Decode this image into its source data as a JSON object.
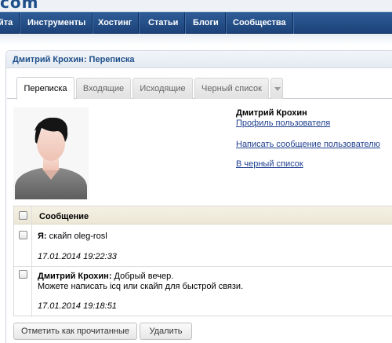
{
  "site": {
    "logo_fragment": "com"
  },
  "nav": {
    "items": [
      {
        "label": "йта"
      },
      {
        "label": "Инструменты"
      },
      {
        "label": "Хостинг"
      },
      {
        "label": "Статьи"
      },
      {
        "label": "Блоги"
      },
      {
        "label": "Сообщества"
      }
    ]
  },
  "panel": {
    "title": "Дмитрий Крохин: Переписка"
  },
  "tabs": [
    {
      "label": "Переписка",
      "active": true
    },
    {
      "label": "Входящие",
      "active": false
    },
    {
      "label": "Исходящие",
      "active": false
    },
    {
      "label": "Черный список",
      "active": false
    }
  ],
  "user": {
    "name": "Дмитрий Крохин",
    "links": {
      "profile": "Профиль пользователя",
      "write_message": "Написать сообщение пользователю",
      "blacklist": "В черный список"
    }
  },
  "messages": {
    "column_header": "Сообщение",
    "rows": [
      {
        "author": "Я:",
        "text": " скайп oleg-rosl",
        "text2": "",
        "date": "17.01.2014 19:22:33"
      },
      {
        "author": "Дмитрий Крохин:",
        "text": " Добрый вечер.",
        "text2": "Можете написать icq или скайп для быстрой связи.",
        "date": "17.01.2014 19:18:51"
      }
    ]
  },
  "buttons": {
    "mark_read": "Отметить как прочитанные",
    "delete": "Удалить"
  },
  "colors": {
    "nav_bg": "#1c4279",
    "title_text": "#1e4f8a",
    "link": "#1f3f8f",
    "table_header_bg": "#ece7d6"
  }
}
